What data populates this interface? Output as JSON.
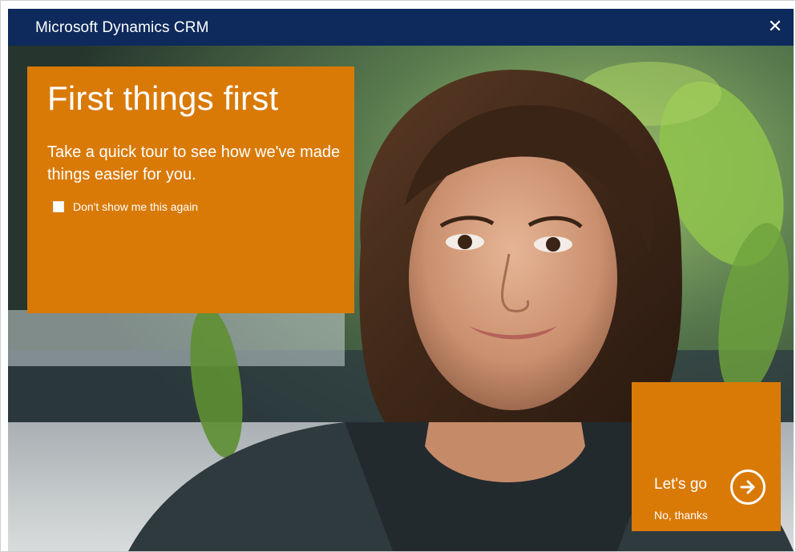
{
  "window": {
    "title": "Microsoft Dynamics CRM",
    "close_glyph": "✕",
    "close_icon": "close-icon"
  },
  "intro": {
    "heading": "First things first",
    "description": "Take a quick tour to see how we've made things easier for you.",
    "dont_show_label": "Don't show me this again",
    "dont_show_checked": false
  },
  "actions": {
    "lets_go_label": "Let's go",
    "lets_go_icon": "arrow-right-circle-icon",
    "no_thanks_label": "No, thanks"
  },
  "colors": {
    "titlebar": "#0e2a5c",
    "tile_orange": "#d97a07",
    "text": "#ffffff"
  }
}
